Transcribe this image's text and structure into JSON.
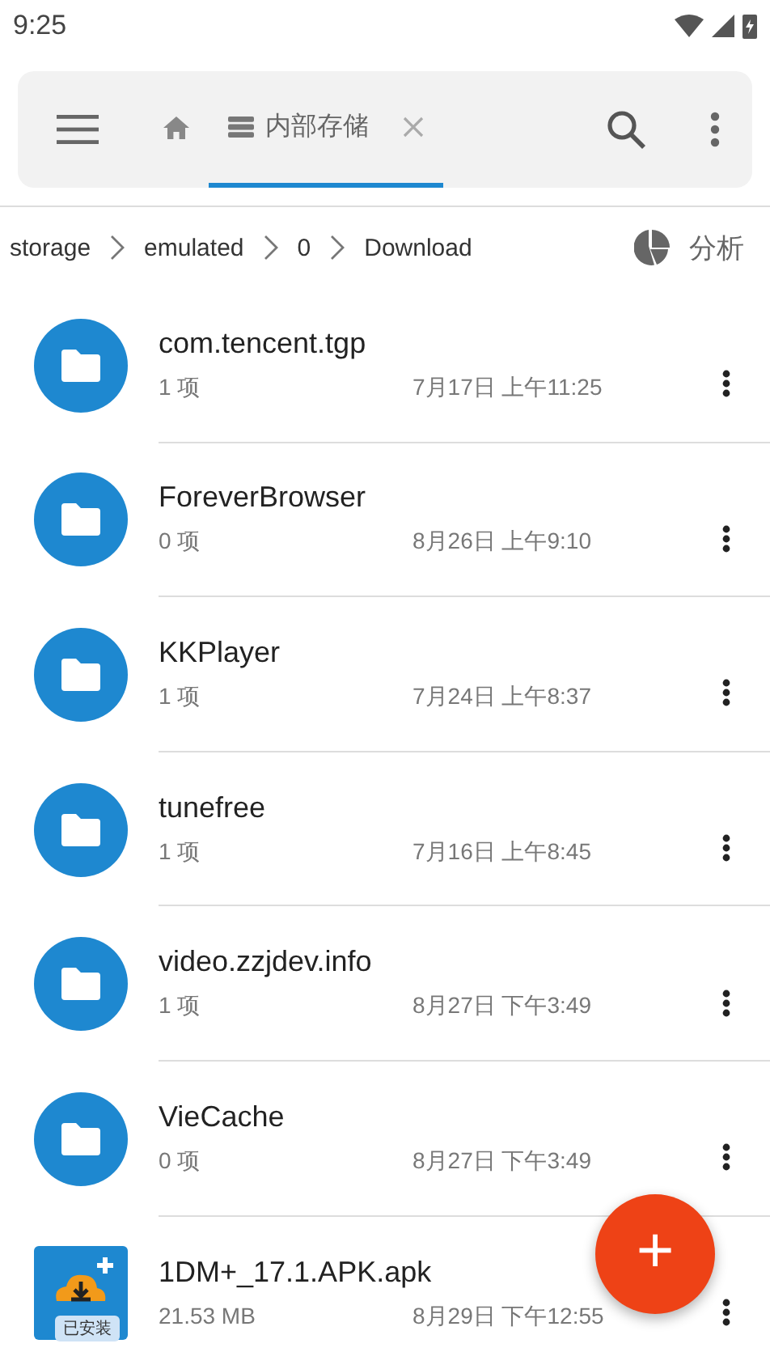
{
  "status_bar": {
    "time": "9:25"
  },
  "tabs": [
    {
      "kind": "home",
      "selected": false
    },
    {
      "kind": "storage",
      "label": "内部存储",
      "selected": true
    }
  ],
  "breadcrumb": [
    "storage",
    "emulated",
    "0",
    "Download"
  ],
  "analyze_button": "分析",
  "files": [
    {
      "kind": "folder",
      "name": "com.tencent.tgp",
      "info": "1 项",
      "date": "7月17日 上午11:25"
    },
    {
      "kind": "folder",
      "name": "ForeverBrowser",
      "info": "0 项",
      "date": "8月26日 上午9:10"
    },
    {
      "kind": "folder",
      "name": "KKPlayer",
      "info": "1 项",
      "date": "7月24日 上午8:37"
    },
    {
      "kind": "folder",
      "name": "tunefree",
      "info": "1 项",
      "date": "7月16日 上午8:45"
    },
    {
      "kind": "folder",
      "name": "video.zzjdev.info",
      "info": "1 项",
      "date": "8月27日 下午3:49"
    },
    {
      "kind": "folder",
      "name": "VieCache",
      "info": "0 项",
      "date": "8月27日 下午3:49"
    },
    {
      "kind": "apk",
      "name": "1DM+_17.1.APK.apk",
      "info": "21.53 MB",
      "date": "8月29日 下午12:55",
      "badge": "已安装"
    }
  ],
  "fab": "+"
}
